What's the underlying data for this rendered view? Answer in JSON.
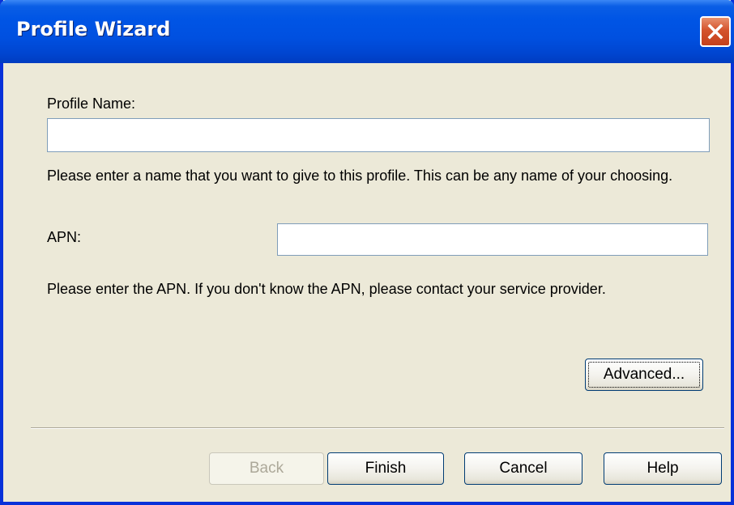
{
  "window": {
    "title": "Profile Wizard"
  },
  "form": {
    "profile_name_label": "Profile Name:",
    "profile_name_value": "",
    "profile_name_help": "Please enter a name that you want to give to this profile. This can be any name of your choosing.",
    "apn_label": "APN:",
    "apn_value": "",
    "apn_help": "Please enter the APN.  If you don't know the APN, please contact your service provider.",
    "advanced_label": "Advanced..."
  },
  "buttons": {
    "back_label": "Back",
    "finish_label": "Finish",
    "cancel_label": "Cancel",
    "help_label": "Help"
  },
  "colors": {
    "titlebar": "#0055e5",
    "dialog_bg": "#ece9d8",
    "close_button": "#d4542d"
  }
}
